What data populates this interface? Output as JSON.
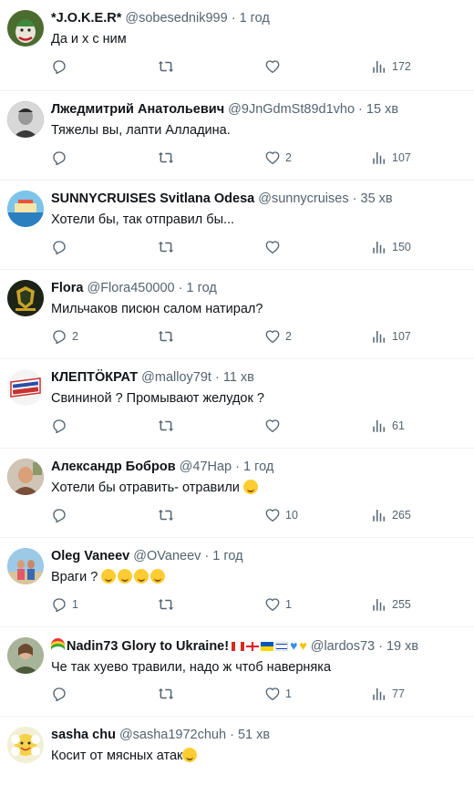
{
  "icons": {
    "reply": "reply-icon",
    "retweet": "retweet-icon",
    "like": "heart-icon",
    "views": "views-icon"
  },
  "tweets": [
    {
      "name": "*J.O.K.E.R*",
      "handle": "@sobesednik999",
      "sep": "·",
      "time": "1 год",
      "text": "Да и х с ним",
      "replies": "",
      "retweets": "",
      "likes": "",
      "views": "172",
      "avatar_color": "#5a7a3a"
    },
    {
      "name": "Лжедмитрий Анатольевич",
      "handle": "@9JnGdmSt89d1vho",
      "sep": "·",
      "time": "15 хв",
      "text": "Тяжелы вы, лапти Алладина.",
      "replies": "",
      "retweets": "",
      "likes": "2",
      "views": "107",
      "avatar_color": "#6b6b6b"
    },
    {
      "name": "SUNNYCRUISES Svitlana Odesa",
      "handle": "@sunnycruises",
      "sep": "·",
      "time": "35 хв",
      "text": "Хотели бы, так отправил бы...",
      "replies": "",
      "retweets": "",
      "likes": "",
      "views": "150",
      "avatar_color": "#4aa0d8"
    },
    {
      "name": "Flora",
      "handle": "@Flora450000",
      "sep": "·",
      "time": "1 год",
      "text": "Мильчаков писюн салом натирал?",
      "replies": "2",
      "retweets": "",
      "likes": "2",
      "views": "107",
      "avatar_color": "#1f2a1a"
    },
    {
      "name": "КЛЕПТÖКРАТ",
      "handle": "@malloy79t",
      "sep": "·",
      "time": "11 хв",
      "text": "Свининой ? Промывают желудок ?",
      "replies": "",
      "retweets": "",
      "likes": "",
      "views": "61",
      "avatar_color": "#c8322f"
    },
    {
      "name": "Александр Бобров",
      "handle": "@47Hap",
      "sep": "·",
      "time": "1 год",
      "text": "Хотели бы отравить- отравили",
      "replies": "",
      "retweets": "",
      "likes": "10",
      "views": "265",
      "avatar_color": "#9a7a60"
    },
    {
      "name": "Oleg Vaneev",
      "handle": "@OVaneev",
      "sep": "·",
      "time": "1 год",
      "text": "Враги ?",
      "replies": "1",
      "retweets": "",
      "likes": "1",
      "views": "255",
      "avatar_color": "#7ea8c8"
    },
    {
      "name": "Nadin73 Glory to Ukraine!",
      "handle": "@lardos73",
      "sep": "·",
      "time": "19 хв",
      "text": "Че так хуево травили, надо ж чтоб наверняка",
      "replies": "",
      "retweets": "",
      "likes": "1",
      "views": "77",
      "avatar_color": "#b48c6a"
    },
    {
      "name": "sasha chu",
      "handle": "@sasha1972chuh",
      "sep": "·",
      "time": "51 хв",
      "text": "Косит от мясных атак",
      "replies": "",
      "retweets": "",
      "likes": "",
      "views": "",
      "avatar_color": "#e9e5c8"
    }
  ]
}
